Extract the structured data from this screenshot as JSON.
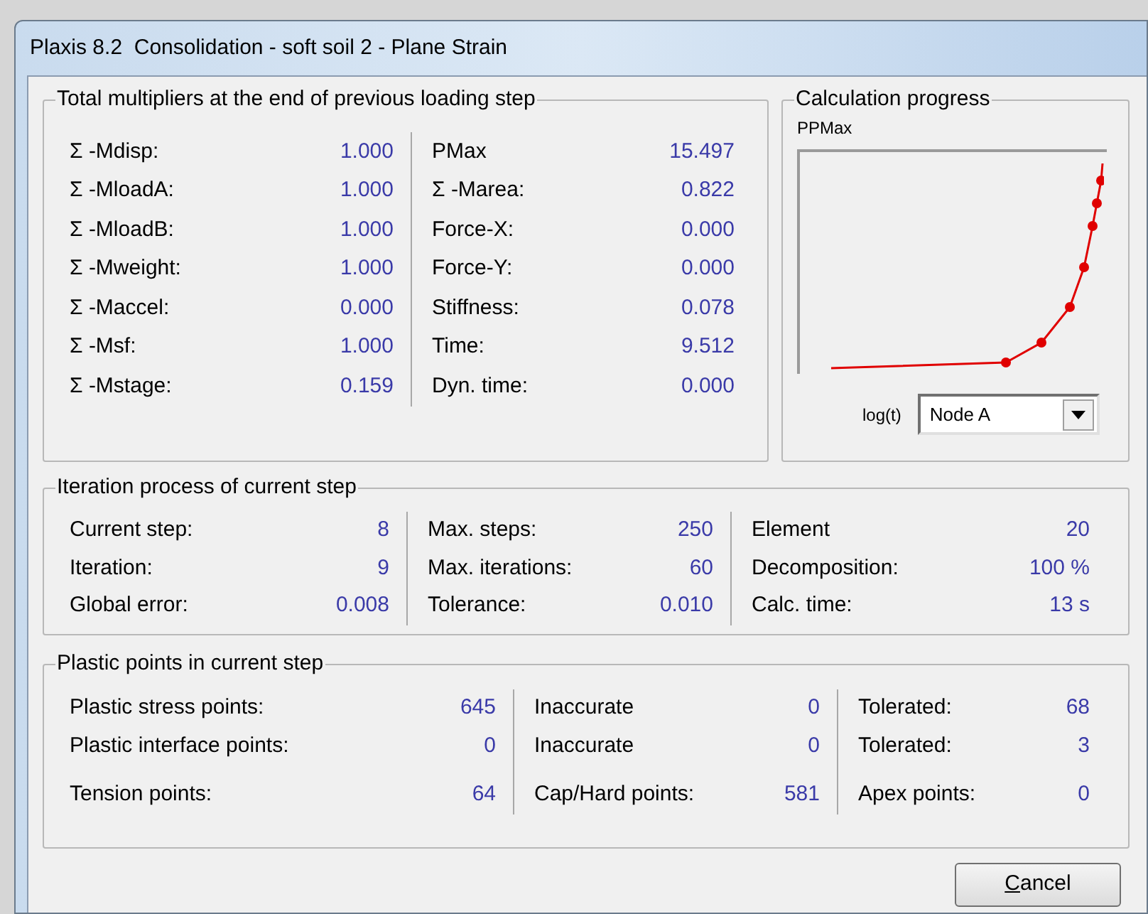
{
  "window": {
    "title": "Plaxis 8.2  Consolidation - soft soil 2 - Plane Strain"
  },
  "multipliers": {
    "title": "Total multipliers at the end of previous loading step",
    "columns": [
      [
        {
          "label": "Σ -Mdisp:",
          "value": "1.000"
        },
        {
          "label": "Σ -MloadA:",
          "value": "1.000"
        },
        {
          "label": "Σ -MloadB:",
          "value": "1.000"
        },
        {
          "label": "Σ -Mweight:",
          "value": "1.000"
        },
        {
          "label": "Σ -Maccel:",
          "value": "0.000"
        },
        {
          "label": "Σ -Msf:",
          "value": "1.000"
        },
        {
          "label": "Σ -Mstage:",
          "value": "0.159"
        }
      ],
      [
        {
          "label": "PMax",
          "value": "15.497"
        },
        {
          "label": "Σ -Marea:",
          "value": "0.822"
        },
        {
          "label": "Force-X:",
          "value": "0.000"
        },
        {
          "label": "Force-Y:",
          "value": "0.000"
        },
        {
          "label": "Stiffness:",
          "value": "0.078"
        },
        {
          "label": "Time:",
          "value": "9.512"
        },
        {
          "label": "Dyn. time:",
          "value": "0.000"
        }
      ]
    ]
  },
  "progress": {
    "title": "Calculation progress",
    "y_label": "PPMax",
    "x_label": "log(t)",
    "node_select": "Node A"
  },
  "iteration": {
    "title": "Iteration process of current step",
    "columns": [
      [
        {
          "label": "Current step:",
          "value": "8"
        },
        {
          "label": "Iteration:",
          "value": "9"
        },
        {
          "label": "Global error:",
          "value": "0.008"
        }
      ],
      [
        {
          "label": "Max. steps:",
          "value": "250"
        },
        {
          "label": "Max. iterations:",
          "value": "60"
        },
        {
          "label": "Tolerance:",
          "value": "0.010"
        }
      ],
      [
        {
          "label": "Element",
          "value": "20"
        },
        {
          "label": "Decomposition:",
          "value": "100 %"
        },
        {
          "label": "Calc. time:",
          "value": "13 s"
        }
      ]
    ]
  },
  "plastic": {
    "title": "Plastic points in current step",
    "columns": [
      [
        {
          "label": "Plastic stress points:",
          "value": "645"
        },
        {
          "label": "Plastic interface points:",
          "value": "0"
        },
        {
          "label": "Tension points:",
          "value": "64"
        }
      ],
      [
        {
          "label": "Inaccurate",
          "value": "0"
        },
        {
          "label": "Inaccurate",
          "value": "0"
        },
        {
          "label": "Cap/Hard points:",
          "value": "581"
        }
      ],
      [
        {
          "label": "Tolerated:",
          "value": "68"
        },
        {
          "label": "Tolerated:",
          "value": "3"
        },
        {
          "label": "Apex points:",
          "value": "0"
        }
      ]
    ]
  },
  "buttons": [
    {
      "label": "Cancel",
      "access_key_underlined": true
    }
  ]
}
